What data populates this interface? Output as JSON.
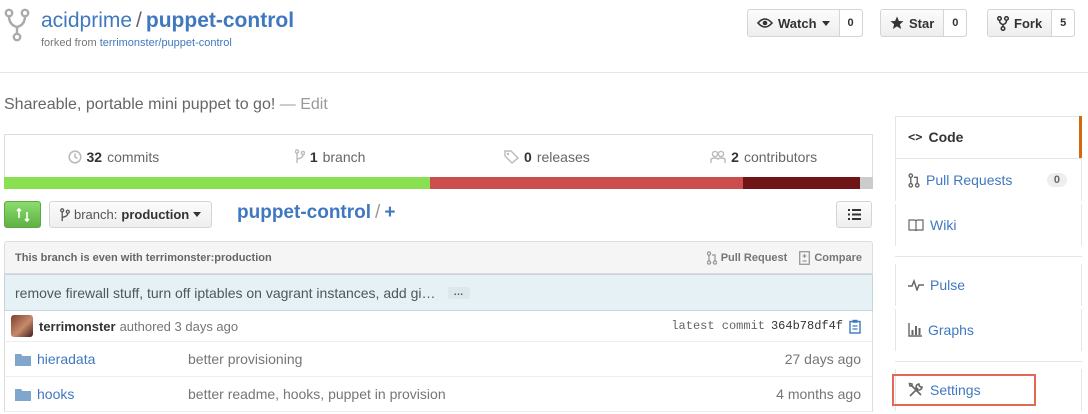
{
  "repo": {
    "owner": "acidprime",
    "separator": "/",
    "name": "puppet-control",
    "forked_prefix": "forked from",
    "forked_from": "terrimonster/puppet-control"
  },
  "actions": {
    "watch": {
      "label": "Watch",
      "count": "0"
    },
    "star": {
      "label": "Star",
      "count": "0"
    },
    "fork": {
      "label": "Fork",
      "count": "5"
    }
  },
  "description": {
    "text": "Shareable, portable mini puppet to go!",
    "edit_sep": "—",
    "edit_label": "Edit"
  },
  "summary": {
    "commits_count": "32",
    "commits_label": "commits",
    "branches_count": "1",
    "branches_label": "branch",
    "releases_count": "0",
    "releases_label": "releases",
    "contributors_count": "2",
    "contributors_label": "contributors"
  },
  "languages": [
    {
      "color": "#89e051",
      "share": 0.49
    },
    {
      "color": "#cc4d4d",
      "share": 0.36
    },
    {
      "color": "#701516",
      "share": 0.135
    },
    {
      "color": "#cccccc",
      "share": 0.015
    }
  ],
  "file_nav": {
    "branch_prefix": "branch:",
    "branch_name": "production",
    "breadcrumb_repo": "puppet-control",
    "breadcrumb_sep": "/",
    "breadcrumb_add": "+"
  },
  "branch_status": {
    "text": "This branch is even with terrimonster:production",
    "pull_request_label": "Pull Request",
    "compare_label": "Compare"
  },
  "latest_commit": {
    "message": "remove firewall stuff, turn off iptables on vagrant instances, add gi…",
    "ellipsis": "…",
    "author": "terrimonster",
    "authored_text": "authored 3 days ago",
    "sha_label": "latest commit",
    "sha": "364b78df4f"
  },
  "files": [
    {
      "name": "hieradata",
      "message": "better provisioning",
      "age": "27 days ago"
    },
    {
      "name": "hooks",
      "message": "better readme, hooks, puppet in provision",
      "age": "4 months ago"
    }
  ],
  "sidebar": {
    "code": "Code",
    "pull_requests": "Pull Requests",
    "pull_requests_count": "0",
    "wiki": "Wiki",
    "pulse": "Pulse",
    "graphs": "Graphs",
    "settings": "Settings"
  },
  "colors": {
    "link": "#4078c0",
    "selected_accent": "#d26911",
    "highlight_box": "#e06a56",
    "compare_green": "#60b044"
  },
  "icons": [
    "repo-forked-icon",
    "eye-icon",
    "star-icon",
    "fork-icon",
    "history-icon",
    "git-branch-icon",
    "tag-icon",
    "organization-icon",
    "compare-icon",
    "list-icon",
    "git-pull-request-icon",
    "diff-icon",
    "clippy-icon",
    "folder-icon",
    "code-icon",
    "book-icon",
    "pulse-icon",
    "graph-icon",
    "tools-icon"
  ]
}
